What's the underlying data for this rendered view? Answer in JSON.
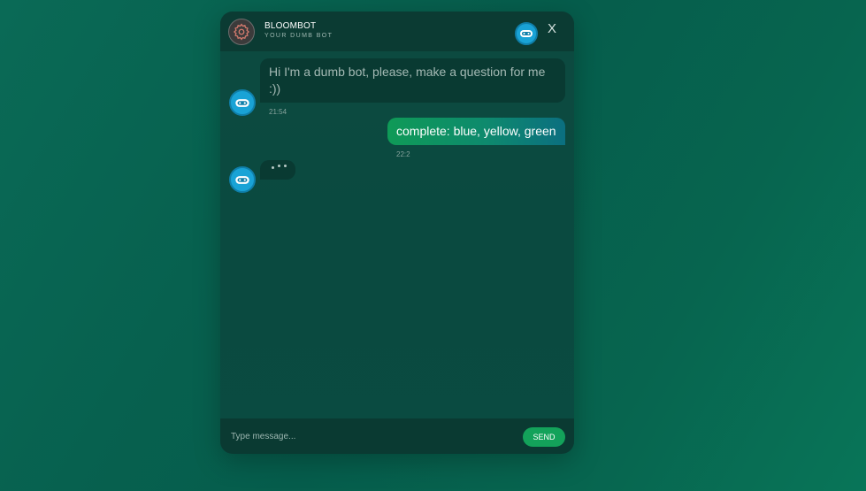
{
  "header": {
    "title": "BLOOMBOT",
    "subtitle": "YOUR DUMB BOT",
    "close_label": "X",
    "settings_icon": "gear-icon",
    "bot_icon": "bot-face-icon"
  },
  "messages": [
    {
      "sender": "bot",
      "text": "Hi I'm a dumb bot, please, make a question for me :))",
      "time": "21:54"
    },
    {
      "sender": "user",
      "text": "complete: blue, yellow, green",
      "time": "22:2"
    },
    {
      "sender": "bot",
      "typing": true
    }
  ],
  "composer": {
    "placeholder": "Type message...",
    "send_label": "SEND"
  },
  "colors": {
    "accent": "#13a25a",
    "bot_avatar": "#19a3d6",
    "header_bg": "#0b3b33",
    "bot_bubble": "#093a32"
  }
}
